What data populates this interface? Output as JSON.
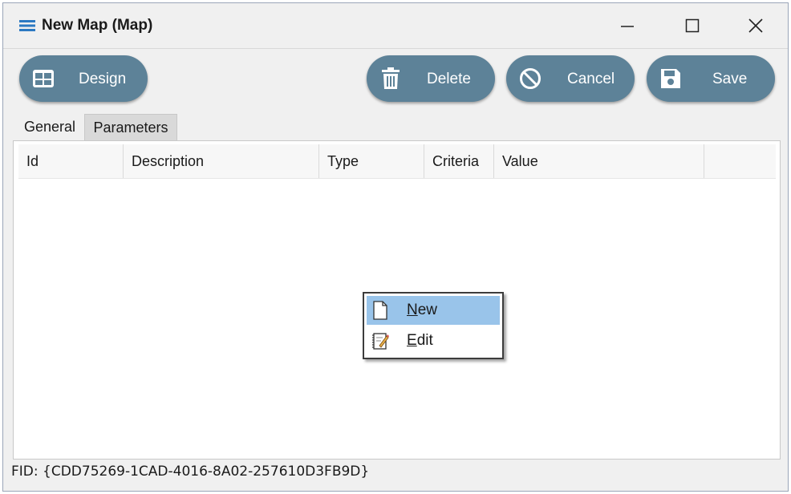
{
  "window": {
    "title": "New Map (Map)",
    "icons": {
      "app": "hamburger-menu-icon",
      "minimize": "minimize-icon",
      "maximize": "maximize-icon",
      "close": "close-icon"
    }
  },
  "toolbar": {
    "design_label": "Design",
    "delete_label": "Delete",
    "cancel_label": "Cancel",
    "save_label": "Save",
    "button_color": "#5d8298"
  },
  "tabs": [
    {
      "label": "General",
      "active": false
    },
    {
      "label": "Parameters",
      "active": true
    }
  ],
  "grid": {
    "columns": [
      "Id",
      "Description",
      "Type",
      "Criteria",
      "Value"
    ],
    "rows": []
  },
  "context_menu": {
    "items": [
      {
        "label": "New",
        "mnemonic": "N",
        "rest": "ew",
        "icon": "new-document-icon",
        "highlighted": true
      },
      {
        "label": "Edit",
        "mnemonic": "E",
        "rest": "dit",
        "icon": "edit-notepad-icon",
        "highlighted": false
      }
    ],
    "highlight_color": "#99c4ea"
  },
  "footer": {
    "fid": "FID: {CDD75269-1CAD-4016-8A02-257610D3FB9D}"
  }
}
